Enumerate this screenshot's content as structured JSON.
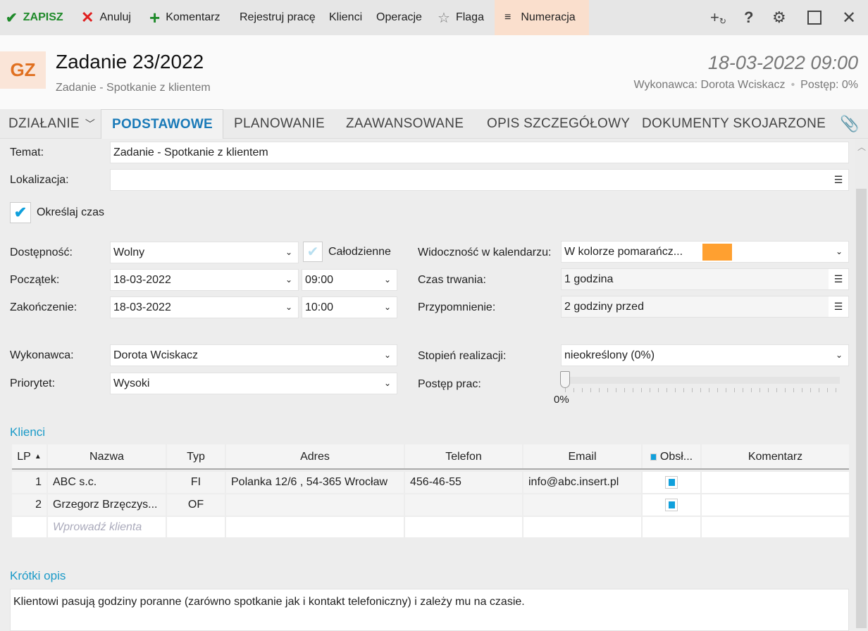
{
  "toolbar": {
    "save": "ZAPISZ",
    "cancel": "Anuluj",
    "comment": "Komentarz",
    "register_work": "Rejestruj pracę",
    "clients": "Klienci",
    "operations": "Operacje",
    "flag": "Flaga",
    "numbering": "Numeracja"
  },
  "header": {
    "badge": "GZ",
    "title": "Zadanie 23/2022",
    "subtitle": "Zadanie - Spotkanie z klientem",
    "datetime": "18-03-2022 09:00",
    "assignee": "Wykonawca: Dorota Wciskacz",
    "separator": "•",
    "progress": "Postęp: 0%"
  },
  "tabs": {
    "action": "DZIAŁANIE",
    "basic": "PODSTAWOWE",
    "planning": "PLANOWANIE",
    "advanced": "ZAAWANSOWANE",
    "description": "OPIS SZCZEGÓŁOWY",
    "documents": "DOKUMENTY SKOJARZONE"
  },
  "form": {
    "subject_label": "Temat:",
    "subject": "Zadanie - Spotkanie z klientem",
    "location_label": "Lokalizacja:",
    "location": "",
    "specify_time": "Określaj czas",
    "availability_label": "Dostępność:",
    "availability": "Wolny",
    "all_day": "Całodzienne",
    "start_label": "Początek:",
    "start_date": "18-03-2022",
    "start_time": "09:00",
    "end_label": "Zakończenie:",
    "end_date": "18-03-2022",
    "end_time": "10:00",
    "calendar_label": "Widoczność w kalendarzu:",
    "calendar": "W kolorze pomarańcz...",
    "calendar_color": "#ffa030",
    "duration_label": "Czas trwania:",
    "duration": "1 godzina",
    "reminder_label": "Przypomnienie:",
    "reminder": "2 godziny przed",
    "assignee_label": "Wykonawca:",
    "assignee": "Dorota Wciskacz",
    "priority_label": "Priorytet:",
    "priority": "Wysoki",
    "completion_label": "Stopień realizacji:",
    "completion": "nieokreślony  (0%)",
    "progress_label": "Postęp prac:",
    "progress_value": 0,
    "progress_text": "0%"
  },
  "clients": {
    "title": "Klienci",
    "columns": [
      "LP",
      "Nazwa",
      "Typ",
      "Adres",
      "Telefon",
      "Email",
      "Obsł...",
      "Komentarz"
    ],
    "rows": [
      {
        "lp": "1",
        "name": "ABC s.c.",
        "type": "FI",
        "address": "Polanka  12/6 , 54-365 Wrocław",
        "phone": "456-46-55",
        "email": "info@abc.insert.pl",
        "comment": ""
      },
      {
        "lp": "2",
        "name": "Grzegorz Brzęczys...",
        "type": "OF",
        "address": "",
        "phone": "",
        "email": "",
        "comment": ""
      }
    ],
    "placeholder": "Wprowadź klienta"
  },
  "short_desc": {
    "title": "Krótki opis",
    "text": "Klientowi pasują godziny poranne (zarówno spotkanie jak i kontakt telefoniczny) i zależy mu na czasie."
  }
}
